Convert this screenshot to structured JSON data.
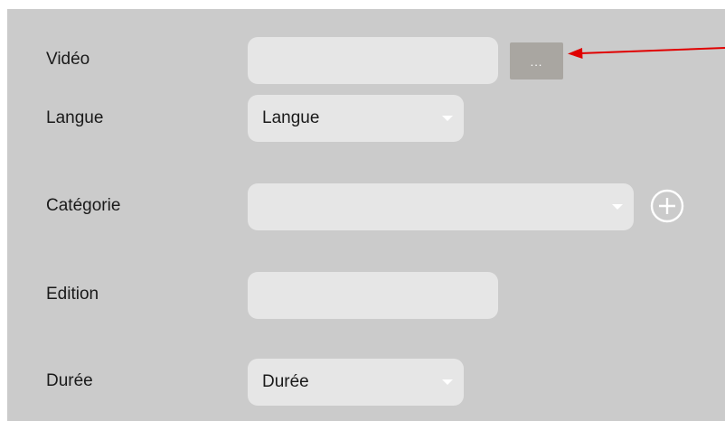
{
  "form": {
    "video": {
      "label": "Vidéo",
      "value": "",
      "browse_label": "..."
    },
    "langue": {
      "label": "Langue",
      "selected": "Langue"
    },
    "categorie": {
      "label": "Catégorie",
      "selected": ""
    },
    "edition": {
      "label": "Edition",
      "value": ""
    },
    "duree": {
      "label": "Durée",
      "selected": "Durée"
    }
  },
  "icons": {
    "add": "plus-circle-icon",
    "caret": "chevron-down-icon",
    "annotation": "red-arrow"
  },
  "colors": {
    "panel_bg": "#cbcbcb",
    "field_bg": "#e6e6e6",
    "button_bg": "#a9a6a1",
    "annotation": "#e00000"
  }
}
